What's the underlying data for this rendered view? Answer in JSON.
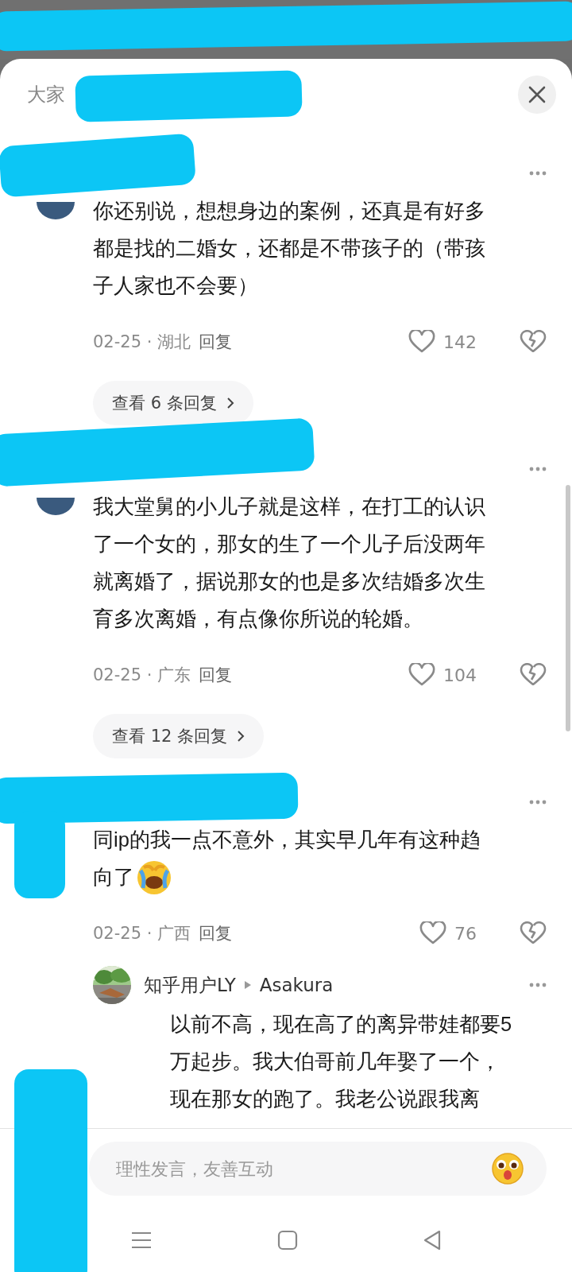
{
  "header": {
    "title": "大家"
  },
  "comments": [
    {
      "lines": [
        "你还别说，想想身边的案例，还真是有好多",
        "都是找的二婚女，还都是不带孩子的（带孩",
        "子人家也不会要）"
      ],
      "avatar": true,
      "emoji": false,
      "meta": "02-25 · 湖北",
      "reply": "回复",
      "likes": "142",
      "replies_link": "查看 6 条回复"
    },
    {
      "lines": [
        "我大堂舅的小儿子就是这样，在打工的认识",
        "了一个女的，那女的生了一个儿子后没两年",
        "就离婚了，据说那女的也是多次结婚多次生",
        "育多次离婚，有点像你所说的轮婚。"
      ],
      "avatar": true,
      "emoji": false,
      "meta": "02-25 · 广东",
      "reply": "回复",
      "likes": "104",
      "replies_link": "查看 12 条回复"
    },
    {
      "lines": [
        "同ip的我一点不意外，其实早几年有这种趋",
        "向了"
      ],
      "avatar": false,
      "emoji": true,
      "meta": "02-25 · 广西",
      "reply": "回复",
      "likes": "76",
      "sub_reply": {
        "author": "知乎用户LY",
        "reply_to": "Asakura",
        "lines": [
          "以前不高，现在高了的离异带娃都要5",
          "万起步。我大伯哥前几年娶了一个，",
          "现在那女的跑了。我老公说跟我离"
        ]
      }
    }
  ],
  "input": {
    "placeholder": "理性发言，友善互动"
  }
}
